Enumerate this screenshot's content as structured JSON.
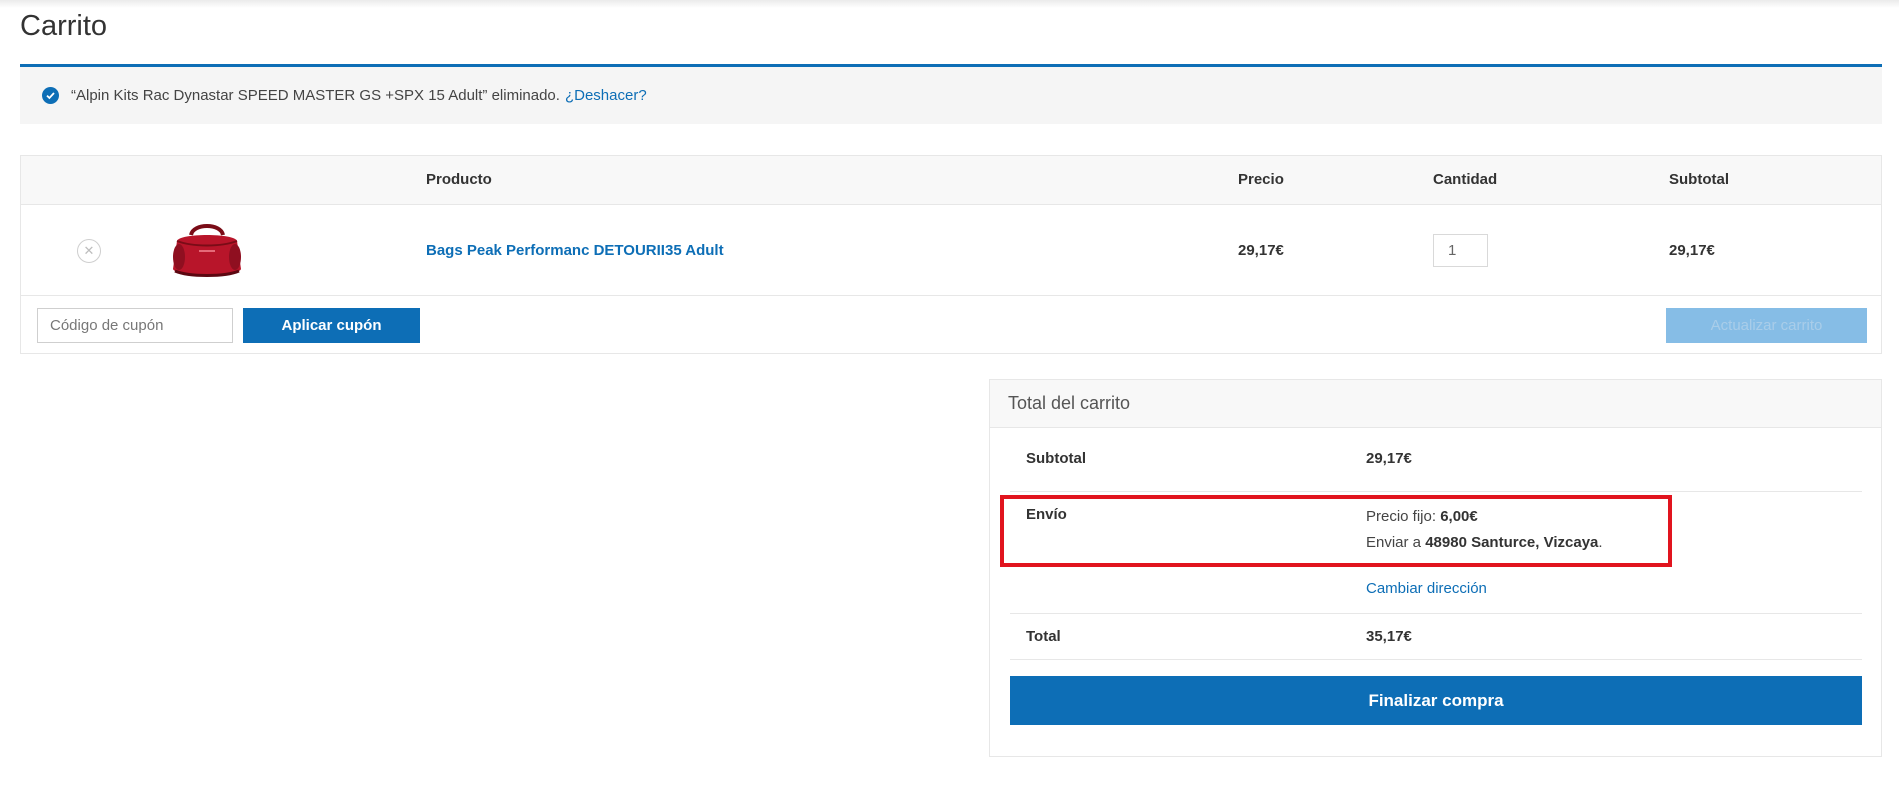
{
  "page": {
    "title": "Carrito"
  },
  "notice": {
    "message": "“Alpin Kits Rac Dynastar SPEED MASTER GS +SPX 15 Adult” eliminado.",
    "undo_link": "¿Deshacer?"
  },
  "cart": {
    "headers": {
      "product": "Producto",
      "price": "Precio",
      "quantity": "Cantidad",
      "subtotal": "Subtotal"
    },
    "items": [
      {
        "name": "Bags Peak Performanc DETOURII35 Adult",
        "price": "29,17€",
        "quantity": "1",
        "subtotal": "29,17€",
        "image_icon": "red-duffel-bag-icon"
      }
    ],
    "coupon_placeholder": "Código de cupón",
    "apply_coupon_label": "Aplicar cupón",
    "update_cart_label": "Actualizar carrito"
  },
  "totals": {
    "heading": "Total del carrito",
    "subtotal_label": "Subtotal",
    "subtotal_value": "29,17€",
    "shipping_label": "Envío",
    "shipping_method_label": "Precio fijo:",
    "shipping_method_value": "6,00€",
    "ship_to_label": "Enviar a",
    "ship_to_value": "48980 Santurce, Vizcaya",
    "ship_to_suffix": ".",
    "change_address_label": "Cambiar dirección",
    "total_label": "Total",
    "total_value": "35,17€",
    "checkout_label": "Finalizar compra"
  },
  "colors": {
    "accent": "#0d6eb6",
    "highlight_box": "#e1141e",
    "disabled_button": "#86bde6"
  }
}
